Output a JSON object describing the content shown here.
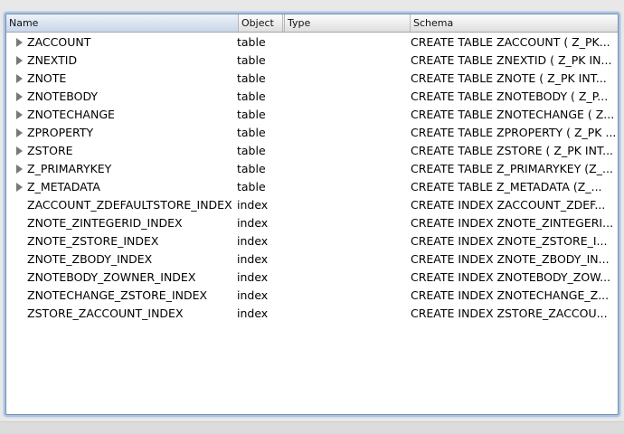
{
  "columns": {
    "name": "Name",
    "object": "Object",
    "type": "Type",
    "schema": "Schema"
  },
  "rows": [
    {
      "name": "ZACCOUNT",
      "object": "table",
      "type": "",
      "schema": "CREATE TABLE ZACCOUNT ( Z_PK...",
      "expandable": true
    },
    {
      "name": "ZNEXTID",
      "object": "table",
      "type": "",
      "schema": "CREATE TABLE ZNEXTID ( Z_PK IN...",
      "expandable": true
    },
    {
      "name": "ZNOTE",
      "object": "table",
      "type": "",
      "schema": "CREATE TABLE ZNOTE ( Z_PK INT...",
      "expandable": true
    },
    {
      "name": "ZNOTEBODY",
      "object": "table",
      "type": "",
      "schema": "CREATE TABLE ZNOTEBODY ( Z_P...",
      "expandable": true
    },
    {
      "name": "ZNOTECHANGE",
      "object": "table",
      "type": "",
      "schema": "CREATE TABLE ZNOTECHANGE ( Z...",
      "expandable": true
    },
    {
      "name": "ZPROPERTY",
      "object": "table",
      "type": "",
      "schema": "CREATE TABLE ZPROPERTY ( Z_PK ...",
      "expandable": true
    },
    {
      "name": "ZSTORE",
      "object": "table",
      "type": "",
      "schema": "CREATE TABLE ZSTORE ( Z_PK INT...",
      "expandable": true
    },
    {
      "name": "Z_PRIMARYKEY",
      "object": "table",
      "type": "",
      "schema": "CREATE TABLE Z_PRIMARYKEY (Z_...",
      "expandable": true
    },
    {
      "name": "Z_METADATA",
      "object": "table",
      "type": "",
      "schema": "CREATE TABLE Z_METADATA (Z_...",
      "expandable": true
    },
    {
      "name": "ZACCOUNT_ZDEFAULTSTORE_INDEX",
      "object": "index",
      "type": "",
      "schema": "CREATE INDEX ZACCOUNT_ZDEF...",
      "expandable": false
    },
    {
      "name": "ZNOTE_ZINTEGERID_INDEX",
      "object": "index",
      "type": "",
      "schema": "CREATE INDEX ZNOTE_ZINTEGERI...",
      "expandable": false
    },
    {
      "name": "ZNOTE_ZSTORE_INDEX",
      "object": "index",
      "type": "",
      "schema": "CREATE INDEX ZNOTE_ZSTORE_I...",
      "expandable": false
    },
    {
      "name": "ZNOTE_ZBODY_INDEX",
      "object": "index",
      "type": "",
      "schema": "CREATE INDEX ZNOTE_ZBODY_IN...",
      "expandable": false
    },
    {
      "name": "ZNOTEBODY_ZOWNER_INDEX",
      "object": "index",
      "type": "",
      "schema": "CREATE INDEX ZNOTEBODY_ZOW...",
      "expandable": false
    },
    {
      "name": "ZNOTECHANGE_ZSTORE_INDEX",
      "object": "index",
      "type": "",
      "schema": "CREATE INDEX ZNOTECHANGE_Z...",
      "expandable": false
    },
    {
      "name": "ZSTORE_ZACCOUNT_INDEX",
      "object": "index",
      "type": "",
      "schema": "CREATE INDEX ZSTORE_ZACCOU...",
      "expandable": false
    }
  ]
}
